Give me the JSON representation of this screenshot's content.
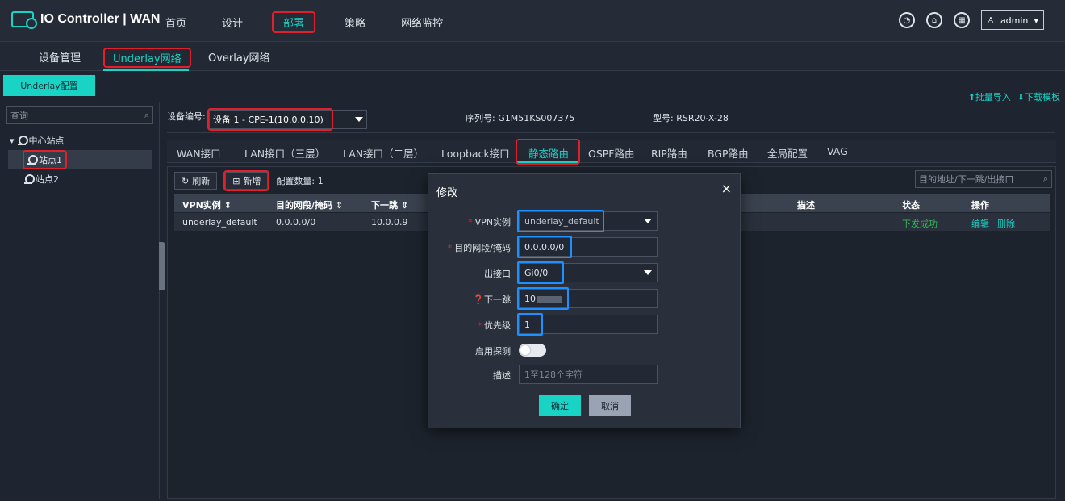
{
  "app": {
    "title": "IO Controller | WAN"
  },
  "nav": [
    "首页",
    "设计",
    "部署",
    "策略",
    "网络监控"
  ],
  "nav_active_index": 2,
  "user": {
    "name": "admin"
  },
  "subtabs": [
    "设备管理",
    "Underlay网络",
    "Overlay网络"
  ],
  "underlay_btn": "Underlay配置",
  "bulk": {
    "import": "批量导入",
    "download": "下载模板"
  },
  "tree": {
    "search_placeholder": "查询",
    "root": "中心站点",
    "nodes": [
      "站点1",
      "站点2"
    ]
  },
  "device": {
    "label": "设备编号:",
    "value": "设备 1 - CPE-1(10.0.0.10)",
    "serial": "序列号: G1M51KS007375",
    "model": "型号: RSR20-X-28"
  },
  "tabs": [
    "WAN接口",
    "LAN接口（三层）",
    "LAN接口（二层）",
    "Loopback接口",
    "静态路由",
    "OSPF路由",
    "RIP路由",
    "BGP路由",
    "全局配置",
    "VAG"
  ],
  "toolbar": {
    "refresh": "刷新",
    "add": "新增",
    "count": "配置数量: 1",
    "filter_placeholder": "目的地址/下一跳/出接口"
  },
  "table": {
    "headers": [
      "VPN实例 ⇕",
      "目的网段/掩码 ⇕",
      "下一跳 ⇕",
      "描述",
      "状态",
      "操作"
    ],
    "row": {
      "vpn": "underlay_default",
      "dest": "0.0.0.0/0",
      "nexthop": "10.0.0.9",
      "status": "下发成功",
      "edit": "编辑",
      "delete": "删除"
    }
  },
  "modal": {
    "title": "修改",
    "close": "×",
    "vpn_label": "VPN实例",
    "vpn_value": "underlay_default",
    "dest_label": "目的网段/掩码",
    "dest_value": "0.0.0.0/0",
    "out_label": "出接口",
    "out_value": "Gi0/0",
    "nexthop_label": "下一跳",
    "nexthop_value": "10",
    "priority_label": "优先级",
    "priority_value": "1",
    "probe_label": "启用探测",
    "desc_label": "描述",
    "desc_placeholder": "1至128个字符",
    "ok": "确定",
    "cancel": "取消"
  },
  "colors": {
    "accent": "#19d3c5",
    "highlight_red": "#e0202a",
    "highlight_blue": "#1e90ff",
    "status_green": "#2bbf52"
  }
}
